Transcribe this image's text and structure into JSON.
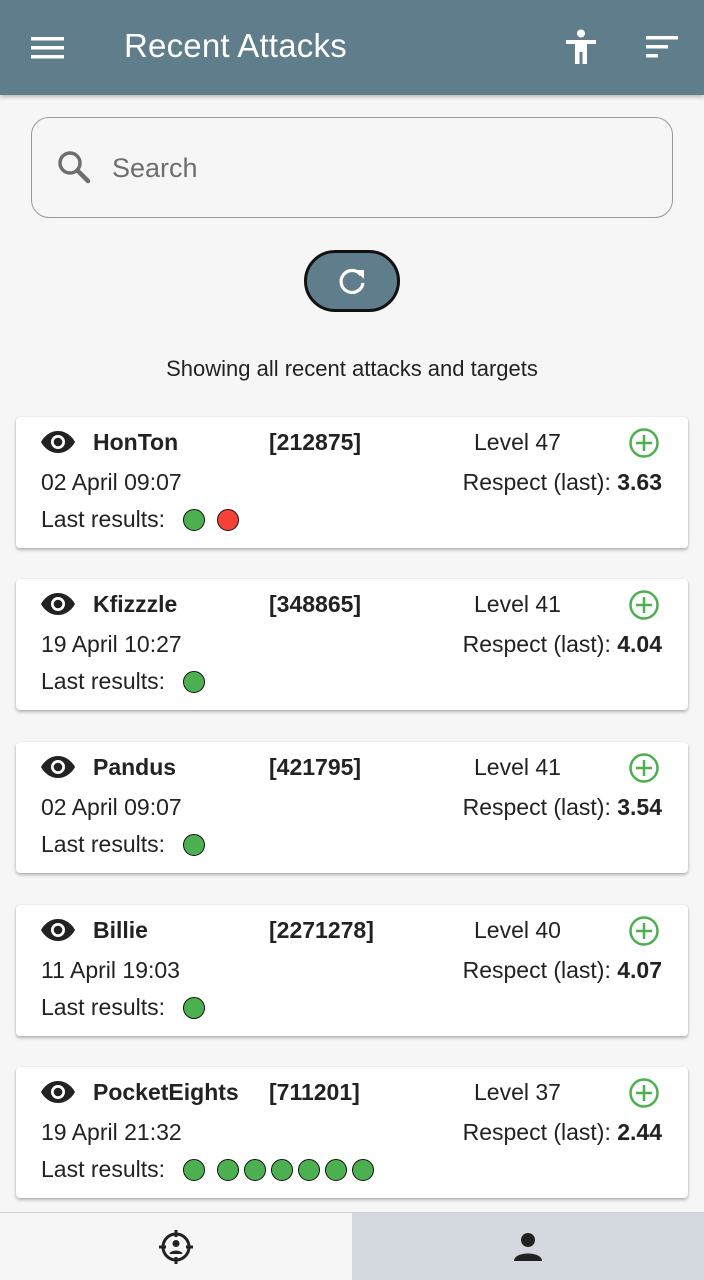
{
  "app_bar": {
    "title": "Recent Attacks",
    "menu_icon": "hamburger-menu-icon",
    "accessibility_icon": "accessibility-icon",
    "sort_icon": "sort-icon",
    "background": "#607d8b"
  },
  "search": {
    "placeholder": "Search",
    "value": "",
    "icon": "search-icon"
  },
  "refresh_button": {
    "icon": "refresh-icon"
  },
  "info_text": "Showing all recent attacks and targets",
  "cards": [
    {
      "name": "HonTon",
      "id": "[212875]",
      "level": "Level 47",
      "date": "02 April 09:07",
      "respect_label": "Respect (last):",
      "respect_value": "3.63",
      "results_label": "Last results:",
      "results": [
        "win",
        "loss"
      ]
    },
    {
      "name": "Kfizzzle",
      "id": "[348865]",
      "level": "Level 41",
      "date": "19 April 10:27",
      "respect_label": "Respect (last):",
      "respect_value": "4.04",
      "results_label": "Last results:",
      "results": [
        "win"
      ]
    },
    {
      "name": "Pandus",
      "id": "[421795]",
      "level": "Level 41",
      "date": "02 April 09:07",
      "respect_label": "Respect (last):",
      "respect_value": "3.54",
      "results_label": "Last results:",
      "results": [
        "win"
      ]
    },
    {
      "name": "Billie",
      "id": "[2271278]",
      "level": "Level 40",
      "date": "11 April 19:03",
      "respect_label": "Respect (last):",
      "respect_value": "4.07",
      "results_label": "Last results:",
      "results": [
        "win"
      ]
    },
    {
      "name": "PocketEights",
      "id": "[711201]",
      "level": "Level 37",
      "date": "19 April 21:32",
      "respect_label": "Respect (last):",
      "respect_value": "2.44",
      "results_label": "Last results:",
      "results": [
        "win",
        "win",
        "win",
        "win",
        "win",
        "win",
        "win"
      ]
    }
  ],
  "bottom_nav": {
    "tabs": [
      {
        "icon": "crosshair-target-icon",
        "active": false
      },
      {
        "icon": "person-icon",
        "active": true
      }
    ]
  },
  "colors": {
    "win": "#4caf50",
    "loss": "#f44336",
    "add_icon": "#4caf50"
  }
}
